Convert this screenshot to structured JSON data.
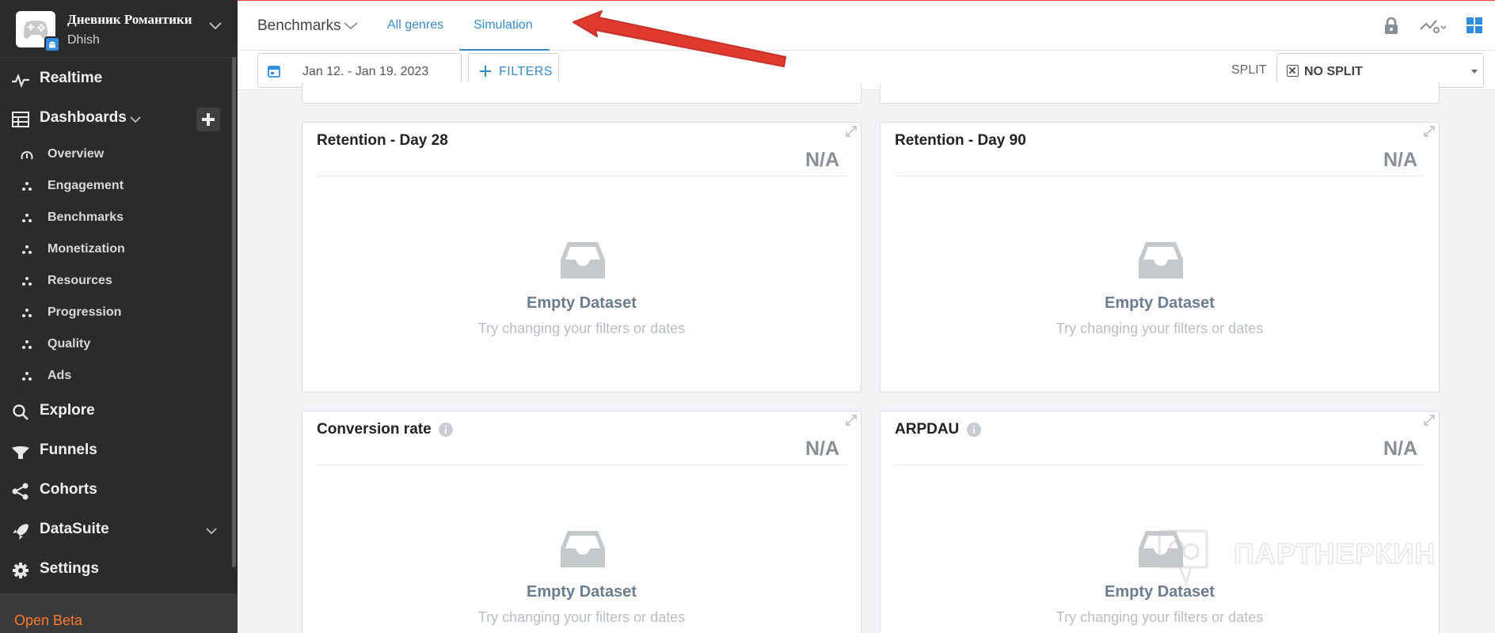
{
  "app": {
    "name": "Дневник Романтики",
    "user": "Dhish"
  },
  "sidebar": {
    "items": [
      {
        "label": "Realtime",
        "icon": "pulse-icon"
      },
      {
        "label": "Dashboards",
        "icon": "grid-icon"
      },
      {
        "label": "Explore",
        "icon": "search-icon"
      },
      {
        "label": "Funnels",
        "icon": "funnel-icon"
      },
      {
        "label": "Cohorts",
        "icon": "share-icon"
      },
      {
        "label": "DataSuite",
        "icon": "rocket-icon"
      },
      {
        "label": "Settings",
        "icon": "gear-icon"
      }
    ],
    "subitems": [
      {
        "label": "Overview",
        "icon": "gauge-icon"
      },
      {
        "label": "Engagement",
        "icon": "dots-icon"
      },
      {
        "label": "Benchmarks",
        "icon": "dots-icon"
      },
      {
        "label": "Monetization",
        "icon": "dots-icon"
      },
      {
        "label": "Resources",
        "icon": "dots-icon"
      },
      {
        "label": "Progression",
        "icon": "dots-icon"
      },
      {
        "label": "Quality",
        "icon": "dots-icon"
      },
      {
        "label": "Ads",
        "icon": "dots-icon"
      }
    ],
    "beta_label": "Open Beta"
  },
  "header": {
    "title": "Benchmarks",
    "tabs": [
      {
        "label": "All genres",
        "active": false
      },
      {
        "label": "Simulation",
        "active": true
      }
    ]
  },
  "filterbar": {
    "date_range": "Jan 12. - Jan 19. 2023",
    "filters_label": "FILTERS",
    "split_label": "SPLIT",
    "split_value": "NO SPLIT"
  },
  "cards": [
    {
      "title": "Retention - Day 28",
      "value": "N/A",
      "empty_title": "Empty Dataset",
      "empty_sub": "Try changing your filters or dates"
    },
    {
      "title": "Retention - Day 90",
      "value": "N/A",
      "empty_title": "Empty Dataset",
      "empty_sub": "Try changing your filters or dates"
    },
    {
      "title": "Conversion rate",
      "value": "N/A",
      "empty_title": "Empty Dataset",
      "empty_sub": "Try changing your filters or dates"
    },
    {
      "title": "ARPDAU",
      "value": "N/A",
      "empty_title": "Empty Dataset",
      "empty_sub": "Try changing your filters or dates"
    }
  ],
  "watermark": "ПАРТНЕРКИН",
  "colors": {
    "sidebar_bg": "#2b2b2b",
    "accent": "#3a8bc8",
    "beta": "#ff7a2e",
    "arrow": "#e03a2f"
  }
}
